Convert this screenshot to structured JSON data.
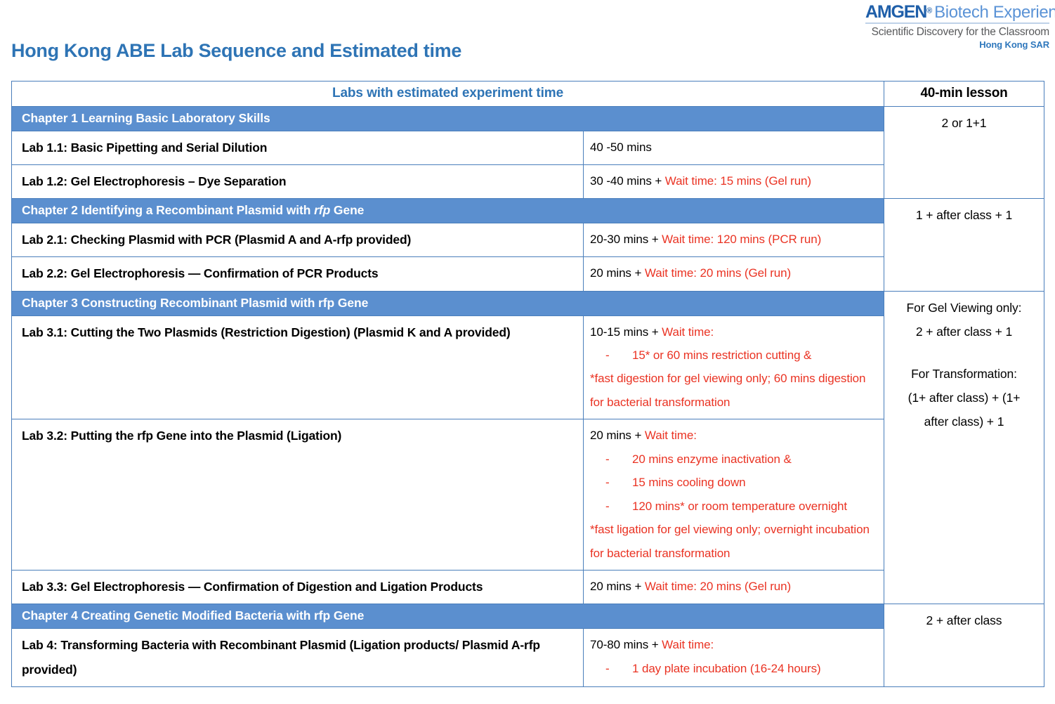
{
  "logo": {
    "brand": "AMGEN",
    "registered": "®",
    "product": "Biotech Experience",
    "tagline": "Scientific Discovery for the Classroom",
    "region": "Hong Kong SAR"
  },
  "page_title": "Hong Kong ABE Lab Sequence and Estimated time",
  "colors": {
    "title_blue": "#2E74B5",
    "chapter_band": "#5B8FCF",
    "border_blue": "#4A7EBB",
    "wait_red": "#EA3323",
    "logo_blue": "#1F5FA9",
    "tagline_gray": "#58595B"
  },
  "table": {
    "headers": {
      "labs": "Labs with estimated experiment time",
      "lesson": "40-min lesson"
    },
    "chapters": [
      {
        "id": "chapter-1",
        "title_prefix": "Chapter 1 Learning Basic Laboratory Skills",
        "title_italic": "",
        "title_suffix": "",
        "lesson": "2 or 1+1",
        "labs": [
          {
            "name": "Lab 1.1: Basic Pipetting and Serial Dilution",
            "time_black": "40 -50 mins",
            "time_red": "",
            "wait_items": [],
            "notes": []
          },
          {
            "name": "Lab 1.2: Gel Electrophoresis – Dye Separation",
            "time_black": "30 -40 mins + ",
            "time_red": "Wait time: 15 mins (Gel run)",
            "wait_items": [],
            "notes": []
          }
        ]
      },
      {
        "id": "chapter-2",
        "title_prefix": "Chapter 2 Identifying a Recombinant Plasmid with ",
        "title_italic": "rfp",
        "title_suffix": " Gene",
        "lesson": "1 + after class + 1",
        "labs": [
          {
            "name": "Lab 2.1: Checking Plasmid with PCR (Plasmid A and A-rfp provided)",
            "time_black": "20-30 mins + ",
            "time_red": "Wait time: 120 mins (PCR run)",
            "wait_items": [],
            "notes": []
          },
          {
            "name": "Lab 2.2: Gel Electrophoresis — Confirmation of PCR Products",
            "time_black": "20 mins + ",
            "time_red": "Wait time: 20 mins (Gel run)",
            "wait_items": [],
            "notes": []
          }
        ]
      },
      {
        "id": "chapter-3",
        "title_prefix": "Chapter 3 Constructing Recombinant Plasmid with rfp Gene",
        "title_italic": "",
        "title_suffix": "",
        "lesson_line1": "For Gel Viewing only:",
        "lesson_line2": "2 + after class + 1",
        "lesson_line3": "For Transformation:",
        "lesson_line4": "(1+ after class) + (1+",
        "lesson_line5": "after class) + 1",
        "labs": [
          {
            "name": "Lab 3.1: Cutting the Two Plasmids (Restriction Digestion) (Plasmid K and A provided)",
            "time_black": "10-15 mins + ",
            "time_red": "Wait time:",
            "wait_items": [
              "15* or 60 mins restriction cutting &"
            ],
            "notes": [
              "*fast digestion for gel viewing only; 60 mins digestion for bacterial transformation"
            ]
          },
          {
            "name": "Lab 3.2: Putting the rfp Gene into the Plasmid (Ligation)",
            "time_black": "20 mins + ",
            "time_red": "Wait time:",
            "wait_items": [
              "20 mins enzyme inactivation &",
              "15 mins cooling down",
              "120 mins* or room temperature overnight"
            ],
            "notes": [
              "*fast ligation for gel viewing only; overnight incubation for bacterial transformation"
            ]
          },
          {
            "name": "Lab 3.3: Gel Electrophoresis — Confirmation of Digestion and Ligation Products",
            "time_black": "20 mins + ",
            "time_red": "Wait time: 20 mins (Gel run)",
            "wait_items": [],
            "notes": []
          }
        ]
      },
      {
        "id": "chapter-4",
        "title_prefix": "Chapter 4 Creating Genetic Modified Bacteria with rfp Gene",
        "title_italic": "",
        "title_suffix": "",
        "lesson": "2 + after class",
        "labs": [
          {
            "name": "Lab 4: Transforming Bacteria with Recombinant Plasmid (Ligation products/ Plasmid A-rfp provided)",
            "time_black": "70-80 mins + ",
            "time_red": "Wait time:",
            "wait_items": [
              "1 day plate incubation (16-24 hours)"
            ],
            "notes": []
          }
        ]
      }
    ]
  }
}
